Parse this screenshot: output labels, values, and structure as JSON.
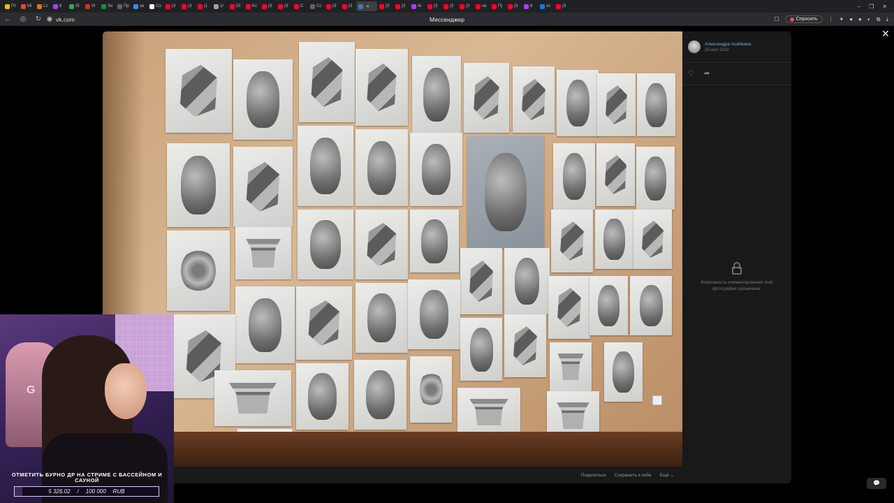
{
  "browser": {
    "tabs": [
      {
        "label": "Пт",
        "color": "#fbbc04"
      },
      {
        "label": "Мі",
        "color": "#ea4335"
      },
      {
        "label": "Lz",
        "color": "#e8710a"
      },
      {
        "label": "8",
        "color": "#a142f4"
      },
      {
        "label": "St",
        "color": "#34a853"
      },
      {
        "label": "Vi",
        "color": "#d93025"
      },
      {
        "label": "Se",
        "color": "#1e8e3e"
      },
      {
        "label": "Пр",
        "color": "#5f6368"
      },
      {
        "label": "se",
        "color": "#4285f4"
      },
      {
        "label": "Co",
        "color": "#ffffff"
      },
      {
        "label": "(3",
        "color": "#ff0033"
      },
      {
        "label": "(3",
        "color": "#ff0033"
      },
      {
        "label": "(1",
        "color": "#ff0033"
      },
      {
        "label": "1/",
        "color": "#9aa0a6"
      },
      {
        "label": "Oi",
        "color": "#ff0033"
      },
      {
        "label": "Kc",
        "color": "#ff0033"
      },
      {
        "label": "(3",
        "color": "#ff0033"
      },
      {
        "label": "(3",
        "color": "#ff0033"
      },
      {
        "label": "C",
        "color": "#ff0033"
      },
      {
        "label": "Cc",
        "color": "#5f6368"
      },
      {
        "label": "(3",
        "color": "#ff0033"
      },
      {
        "label": "(3",
        "color": "#ff0033"
      },
      {
        "label": "",
        "color": "#4a76a8",
        "active": true
      },
      {
        "label": "(3",
        "color": "#ff0033"
      },
      {
        "label": "(3",
        "color": "#ff0033"
      },
      {
        "label": "Ai",
        "color": "#a142f4"
      },
      {
        "label": "(3",
        "color": "#ff0033"
      },
      {
        "label": "(3",
        "color": "#ff0033"
      },
      {
        "label": "(3",
        "color": "#ff0033"
      },
      {
        "label": "че",
        "color": "#ff0033"
      },
      {
        "label": "П(",
        "color": "#ff0033"
      },
      {
        "label": "(3",
        "color": "#ff0033"
      },
      {
        "label": "8",
        "color": "#a142f4"
      },
      {
        "label": "ss",
        "color": "#1a73e8"
      },
      {
        "label": "(3",
        "color": "#ff0033"
      }
    ],
    "url": "vk.com",
    "page_title": "Мессенджер",
    "ask_label": "Спросить"
  },
  "viewer": {
    "author_name": "Александра Асейкина",
    "author_date": "25 июл 2018",
    "like_icon": "heart-icon",
    "share_icon": "share-icon",
    "comments_locked_text": "Возможность комментирования этой фотографии ограничена.",
    "share_label": "Поделиться",
    "save_label": "Сохранить к себе",
    "more_label": "Ещё ⌄"
  },
  "stream": {
    "goal_title": "ОТМЕТИТЬ БУРНО ДР НА СТРИМЕ С БАССЕЙНОМ И САУНОЙ",
    "raised": "5 326.02",
    "separator": "/",
    "goal": "100 000",
    "currency": "RUB",
    "progress_fraction": 0.053
  }
}
